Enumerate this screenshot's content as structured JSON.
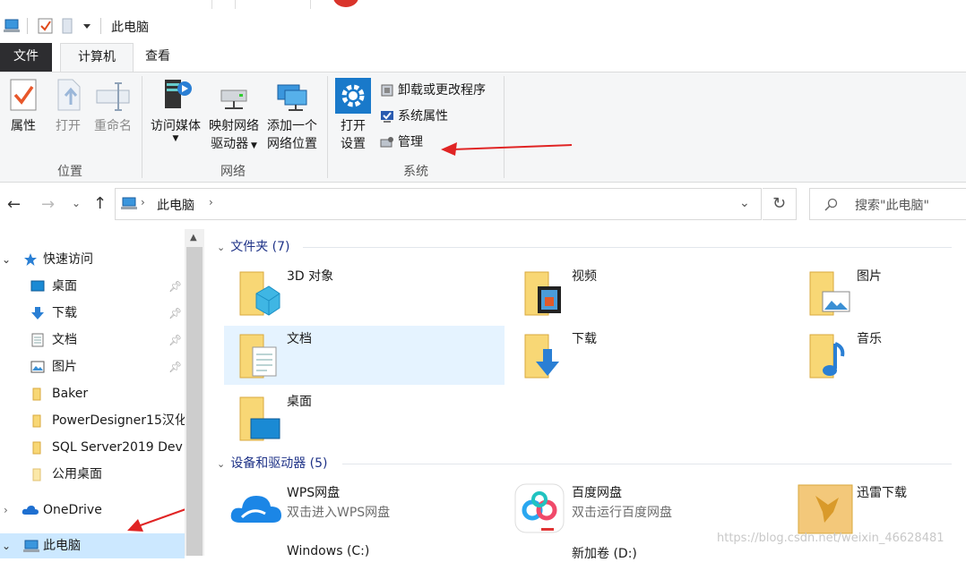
{
  "window": {
    "title": "此电脑"
  },
  "tabs": {
    "file": "文件",
    "computer": "计算机",
    "view": "查看"
  },
  "ribbon": {
    "location": {
      "properties": "属性",
      "open": "打开",
      "rename": "重命名",
      "group": "位置"
    },
    "network": {
      "access_media": "访问媒体",
      "map_drive_1": "映射网络",
      "map_drive_2": "驱动器",
      "add_location_1": "添加一个",
      "add_location_2": "网络位置",
      "group": "网络"
    },
    "system": {
      "open_settings_1": "打开",
      "open_settings_2": "设置",
      "uninstall": "卸载或更改程序",
      "sys_props": "系统属性",
      "manage": "管理",
      "group": "系统"
    }
  },
  "address": {
    "path": "此电脑",
    "search_placeholder": "搜索\"此电脑\""
  },
  "nav": {
    "quick_access": "快速访问",
    "items": [
      {
        "label": "桌面",
        "pinned": true
      },
      {
        "label": "下载",
        "pinned": true
      },
      {
        "label": "文档",
        "pinned": true
      },
      {
        "label": "图片",
        "pinned": true
      },
      {
        "label": "Baker"
      },
      {
        "label": "PowerDesigner15汉化"
      },
      {
        "label": "SQL Server2019 Dev"
      },
      {
        "label": "公用桌面"
      }
    ],
    "onedrive": "OneDrive",
    "this_pc": "此电脑"
  },
  "content": {
    "folders_header": "文件夹 (7)",
    "folders": [
      "3D 对象",
      "视频",
      "图片",
      "文档",
      "下载",
      "音乐",
      "桌面"
    ],
    "devices_header": "设备和驱动器 (5)",
    "devices": [
      {
        "name": "WPS网盘",
        "desc": "双击进入WPS网盘"
      },
      {
        "name": "百度网盘",
        "desc": "双击运行百度网盘"
      },
      {
        "name": "迅雷下载",
        "desc": ""
      },
      {
        "name": "Windows (C:)",
        "desc": ""
      },
      {
        "name": "新加卷 (D:)",
        "desc": ""
      }
    ]
  },
  "watermark": "https://blog.csdn.net/weixin_46628481",
  "colors": {
    "accent": "#1e3287",
    "selection": "#e5f3ff",
    "ribbon_bg": "#f5f6f7",
    "arrow": "#e02424"
  }
}
